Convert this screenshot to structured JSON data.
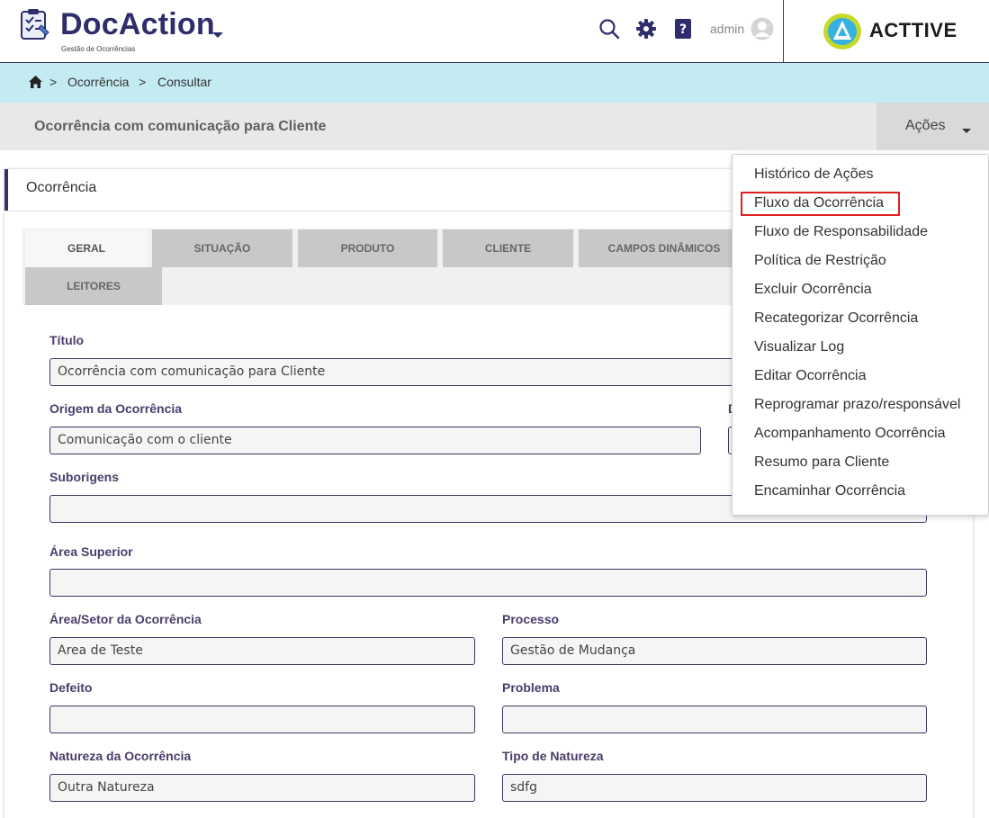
{
  "header": {
    "brand": "DocAction",
    "brand_subtitle": "Gestão de Ocorrências",
    "user": "admin",
    "partner_logo_text": "ACTTIVE"
  },
  "breadcrumb": {
    "items": [
      "Ocorrência",
      "Consultar"
    ],
    "separator": ">"
  },
  "titlebar": {
    "title": "Ocorrência com comunicação para Cliente",
    "actions_label": "Ações"
  },
  "card": {
    "title": "Ocorrência"
  },
  "tabs": [
    {
      "label": "GERAL",
      "active": true
    },
    {
      "label": "SITUAÇÃO"
    },
    {
      "label": "PRODUTO"
    },
    {
      "label": "CLIENTE"
    },
    {
      "label": "CAMPOS DINÂMICOS"
    },
    {
      "label": "LEITORES"
    }
  ],
  "form": {
    "titulo": {
      "label": "Título",
      "value": "Ocorrência  com comunicação para Cliente"
    },
    "origem": {
      "label": "Origem da Ocorrência",
      "value": "Comunicação com o cliente"
    },
    "hidden_label_initial": "D",
    "suborigens": {
      "label": "Suborigens",
      "value": ""
    },
    "area_superior": {
      "label": "Área Superior",
      "value": ""
    },
    "area_setor": {
      "label": "Área/Setor da Ocorrência",
      "value": "Area de Teste"
    },
    "processo": {
      "label": "Processo",
      "value": "Gestão de Mudança"
    },
    "defeito": {
      "label": "Defeito",
      "value": ""
    },
    "problema": {
      "label": "Problema",
      "value": ""
    },
    "natureza": {
      "label": "Natureza da Ocorrência",
      "value": "Outra Natureza"
    },
    "tipo_natureza": {
      "label": "Tipo de Natureza",
      "value": "sdfg"
    }
  },
  "actions_menu": {
    "items": [
      "Histórico de Ações",
      "Fluxo da Ocorrência",
      "Fluxo de Responsabilidade",
      "Política de Restrição",
      "Excluir Ocorrência",
      "Recategorizar Ocorrência",
      "Visualizar Log",
      "Editar Ocorrência",
      "Reprogramar prazo/responsável",
      "Acompanhamento Ocorrência",
      "Resumo para Cliente",
      "Encaminhar Ocorrência"
    ],
    "highlighted": "Fluxo da Ocorrência"
  },
  "colors": {
    "brand": "#2f2d6b",
    "breadcrumb_bg": "#c4eaf2",
    "label": "#4a3d6b",
    "highlight_border": "#e02020"
  }
}
